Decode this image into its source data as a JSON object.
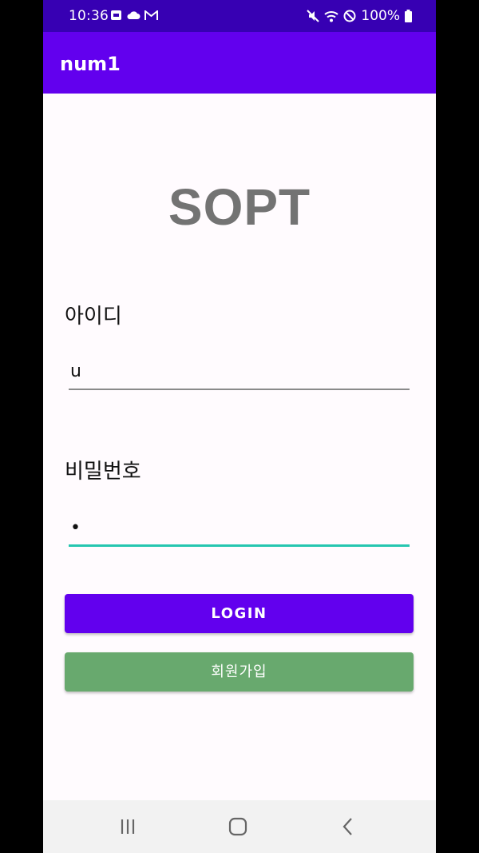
{
  "status_bar": {
    "time": "10:36",
    "battery": "100%",
    "icons_left": [
      "message-icon",
      "cloud-icon",
      "gmail-icon"
    ],
    "icons_right": [
      "mute-icon",
      "wifi-icon",
      "do-not-disturb-icon",
      "battery-icon"
    ]
  },
  "app_bar": {
    "title": "num1"
  },
  "logo": "SOPT",
  "login_form": {
    "id_label": "아이디",
    "id_value": "u",
    "password_label": "비밀번호",
    "password_value": "•"
  },
  "buttons": {
    "login_label": "LOGIN",
    "signup_label": "회원가입"
  },
  "nav_bar": {
    "items": [
      "recent-apps-icon",
      "home-icon",
      "back-icon"
    ]
  },
  "colors": {
    "status_bar": "#3700b3",
    "app_bar": "#6200ee",
    "login_button": "#6200ee",
    "signup_button": "#68a96e",
    "focus_underline": "#26c6b0"
  }
}
